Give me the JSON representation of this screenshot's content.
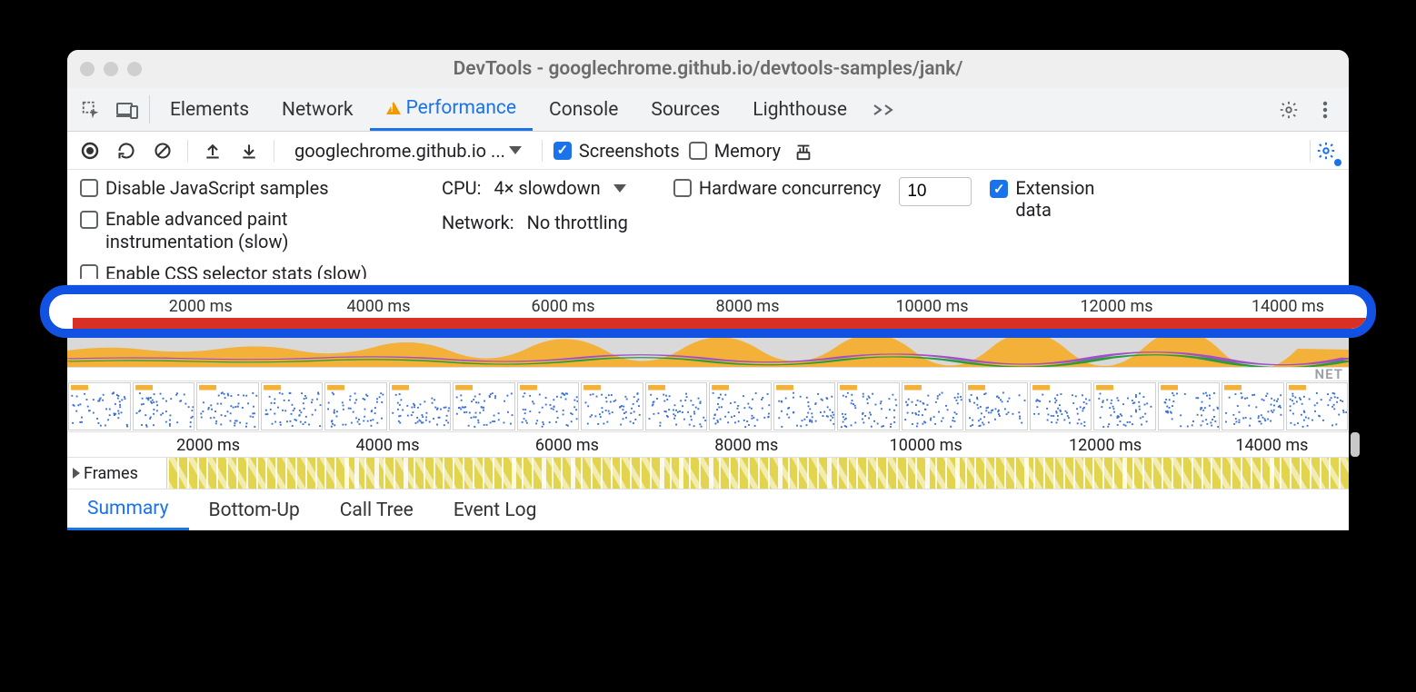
{
  "window": {
    "title": "DevTools - googlechrome.github.io/devtools-samples/jank/"
  },
  "tabs": {
    "items": [
      "Elements",
      "Network",
      "Performance",
      "Console",
      "Sources",
      "Lighthouse"
    ],
    "active_index": 2
  },
  "toolbar": {
    "domain_selector": "googlechrome.github.io ...",
    "screenshots_label": "Screenshots",
    "memory_label": "Memory",
    "screenshots_checked": true,
    "memory_checked": false
  },
  "settings": {
    "disable_js_label": "Disable JavaScript samples",
    "adv_paint_label": "Enable advanced paint instrumentation (slow)",
    "css_stats_label": "Enable CSS selector stats (slow)",
    "cpu_label": "CPU:",
    "cpu_value": "4× slowdown",
    "network_label": "Network:",
    "network_value": "No throttling",
    "hw_label": "Hardware concurrency",
    "hw_value": "10",
    "ext_label": "Extension data",
    "disable_js_checked": false,
    "adv_paint_checked": false,
    "css_stats_checked": false,
    "hw_checked": false,
    "ext_checked": true
  },
  "timeline": {
    "ticks": [
      "2000 ms",
      "4000 ms",
      "6000 ms",
      "8000 ms",
      "10000 ms",
      "12000 ms",
      "14000 ms"
    ],
    "net_label": "NET",
    "frames_label": "Frames"
  },
  "bottom_tabs": {
    "items": [
      "Summary",
      "Bottom-Up",
      "Call Tree",
      "Event Log"
    ],
    "active_index": 0
  },
  "colors": {
    "accent": "#1a73e8",
    "highlight_ring": "#1152e2",
    "red": "#d93025",
    "frames_yellow": "#e3d44f"
  }
}
